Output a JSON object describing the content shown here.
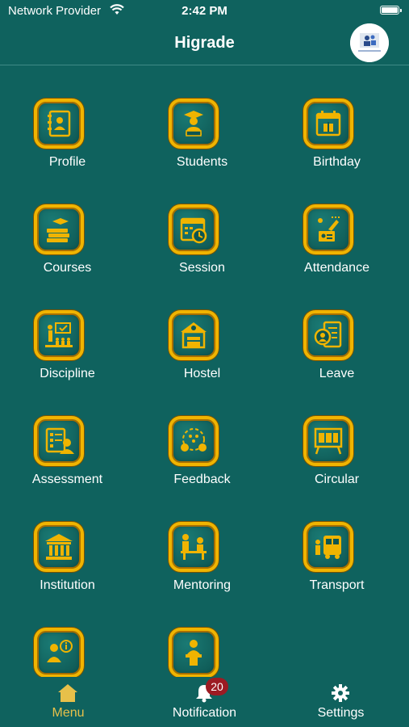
{
  "status_bar": {
    "carrier": "Network Provider",
    "time": "2:42 PM"
  },
  "header": {
    "title": "Higrade"
  },
  "colors": {
    "background": "#0f625e",
    "gold": "#f0b400",
    "active_tab": "#e7c04a",
    "badge": "#9c1b23"
  },
  "menu": [
    {
      "label": "Profile",
      "icon": "contact-book-icon"
    },
    {
      "label": "Students",
      "icon": "graduate-student-icon"
    },
    {
      "label": "Birthday",
      "icon": "calendar-gift-icon"
    },
    {
      "label": "Courses",
      "icon": "books-graduation-cap-icon"
    },
    {
      "label": "Session",
      "icon": "calendar-clock-icon"
    },
    {
      "label": "Attendance",
      "icon": "attendance-touch-icon"
    },
    {
      "label": "Discipline",
      "icon": "classroom-teacher-icon"
    },
    {
      "label": "Hostel",
      "icon": "hostel-building-icon"
    },
    {
      "label": "Leave",
      "icon": "leave-document-icon"
    },
    {
      "label": "Assessment",
      "icon": "assessment-checklist-icon"
    },
    {
      "label": "Feedback",
      "icon": "feedback-people-icon"
    },
    {
      "label": "Circular",
      "icon": "notice-board-icon"
    },
    {
      "label": "Institution",
      "icon": "institution-building-icon"
    },
    {
      "label": "Mentoring",
      "icon": "mentoring-desk-icon"
    },
    {
      "label": "Transport",
      "icon": "school-bus-icon"
    },
    {
      "label": "",
      "icon": "info-speaker-icon"
    },
    {
      "label": "",
      "icon": "podium-speaker-icon"
    }
  ],
  "tabs": {
    "menu": {
      "label": "Menu",
      "icon": "home-icon"
    },
    "notification": {
      "label": "Notification",
      "icon": "bell-icon",
      "badge": "20"
    },
    "settings": {
      "label": "Settings",
      "icon": "gear-icon"
    }
  }
}
